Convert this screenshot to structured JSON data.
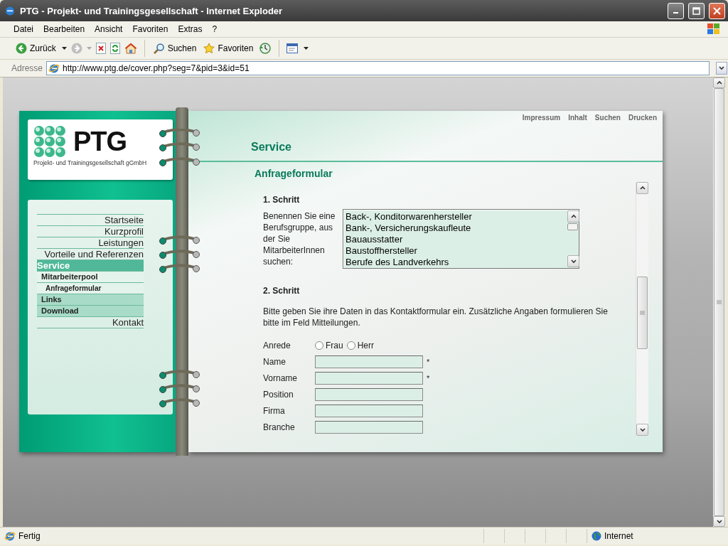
{
  "window": {
    "title": "PTG - Projekt- und Trainingsgesellschaft - Internet Exploder"
  },
  "menu": [
    "Datei",
    "Bearbeiten",
    "Ansicht",
    "Favoriten",
    "Extras",
    "?"
  ],
  "toolbar": {
    "back": "Zurück",
    "search": "Suchen",
    "favorites": "Favoriten"
  },
  "address": {
    "label": "Adresse",
    "url": "http://www.ptg.de/cover.php?seg=7&pid=3&id=51"
  },
  "site": {
    "logo_text": "PTG",
    "logo_subtitle": "Projekt- und Trainingsgesellschaft gGmbH",
    "nav": [
      {
        "label": "Startseite",
        "kind": "main",
        "selected": false
      },
      {
        "label": "Kurzprofil",
        "kind": "main",
        "selected": false
      },
      {
        "label": "Leistungen",
        "kind": "main",
        "selected": false
      },
      {
        "label": "Vorteile und Referenzen",
        "kind": "main",
        "selected": false
      },
      {
        "label": "Service",
        "kind": "section",
        "selected": true
      },
      {
        "label": "Mitarbeiterpool",
        "kind": "sub",
        "selected": false
      },
      {
        "label": "Anfrageformular",
        "kind": "subsub",
        "selected": false
      },
      {
        "label": "Links",
        "kind": "group",
        "selected": false
      },
      {
        "label": "Download",
        "kind": "group",
        "selected": false
      },
      {
        "label": "Kontakt",
        "kind": "main",
        "selected": false
      }
    ],
    "top_links": [
      "Impressum",
      "Inhalt",
      "Suchen",
      "Drucken"
    ],
    "heading": "Service",
    "subheading": "Anfrageformular",
    "step1": {
      "title": "1. Schritt",
      "prompt": "Benennen Sie eine Berufsgruppe, aus der Sie MitarbeiterInnen suchen:",
      "options": [
        {
          "label": "Back-, Konditorwarenhersteller",
          "selected": false
        },
        {
          "label": "Bank-, Versicherungskaufleute",
          "selected": false
        },
        {
          "label": "Bauausstatter",
          "selected": false
        },
        {
          "label": "Baustoffhersteller",
          "selected": false
        },
        {
          "label": "Berufe des Landverkehrs",
          "selected": false
        }
      ]
    },
    "step2": {
      "title": "2. Schritt",
      "text": "Bitte geben Sie ihre Daten in das Kontaktformular ein. Zusätzliche Angaben formulieren Sie bitte im Feld Mitteilungen.",
      "salutation": {
        "label": "Anrede",
        "options": [
          {
            "label": "Frau",
            "checked": false
          },
          {
            "label": "Herr",
            "checked": false
          }
        ]
      },
      "fields": [
        {
          "label": "Name",
          "mark": "*"
        },
        {
          "label": "Vorname",
          "mark": "*"
        },
        {
          "label": "Position"
        },
        {
          "label": "Firma"
        },
        {
          "label": "Branche"
        }
      ]
    }
  },
  "status_bar": {
    "text": "Fertig",
    "zone": "Internet"
  }
}
